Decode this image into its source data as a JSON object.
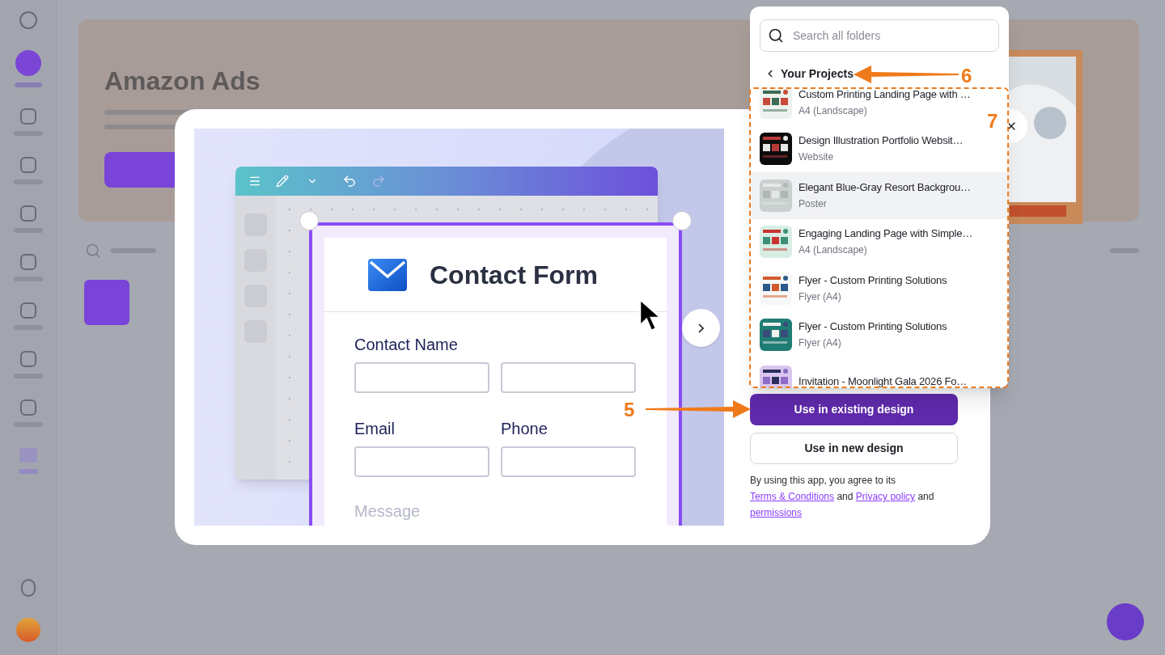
{
  "background": {
    "banner_title": "Amazon Ads"
  },
  "preview": {
    "title": "Contact Form",
    "labels": [
      "Contact Name",
      "Email",
      "Phone",
      "Message"
    ]
  },
  "folder_picker": {
    "search": {
      "placeholder": "Search all folders"
    },
    "breadcrumb": "Your Projects",
    "projects": [
      {
        "title": "Custom Printing Landing Page with …",
        "type": "A4 (Landscape)",
        "highlighted": false
      },
      {
        "title": "Design Illustration Portfolio Websit…",
        "type": "Website",
        "highlighted": false
      },
      {
        "title": "Elegant Blue-Gray Resort Backgrou…",
        "type": "Poster",
        "highlighted": true
      },
      {
        "title": "Engaging Landing Page with Simple…",
        "type": "A4 (Landscape)",
        "highlighted": false
      },
      {
        "title": "Flyer - Custom Printing Solutions",
        "type": "Flyer (A4)",
        "highlighted": false
      },
      {
        "title": "Flyer - Custom Printing Solutions",
        "type": "Flyer (A4)",
        "highlighted": false
      },
      {
        "title": "Invitation - Moonlight Gala 2026 Fo…",
        "highlighted": false
      }
    ]
  },
  "buttons": [
    {
      "label": "Use in existing design",
      "kind": "primary"
    },
    {
      "label": "Use in new design",
      "kind": "secondary"
    }
  ],
  "terms": [
    {
      "text": "By using this app, you agree to its ",
      "kind": "text"
    },
    {
      "text": "Terms & Conditions",
      "kind": "link"
    },
    {
      "text": " and ",
      "kind": "text"
    },
    {
      "text": "Privacy policy",
      "kind": "link"
    },
    {
      "text": " and ",
      "kind": "text"
    },
    {
      "text": "permissions",
      "kind": "link"
    }
  ],
  "annotations": [
    {
      "kind": "arrow",
      "label": "6"
    },
    {
      "kind": "frame",
      "label": "7"
    },
    {
      "kind": "arrow",
      "label": "5"
    }
  ]
}
